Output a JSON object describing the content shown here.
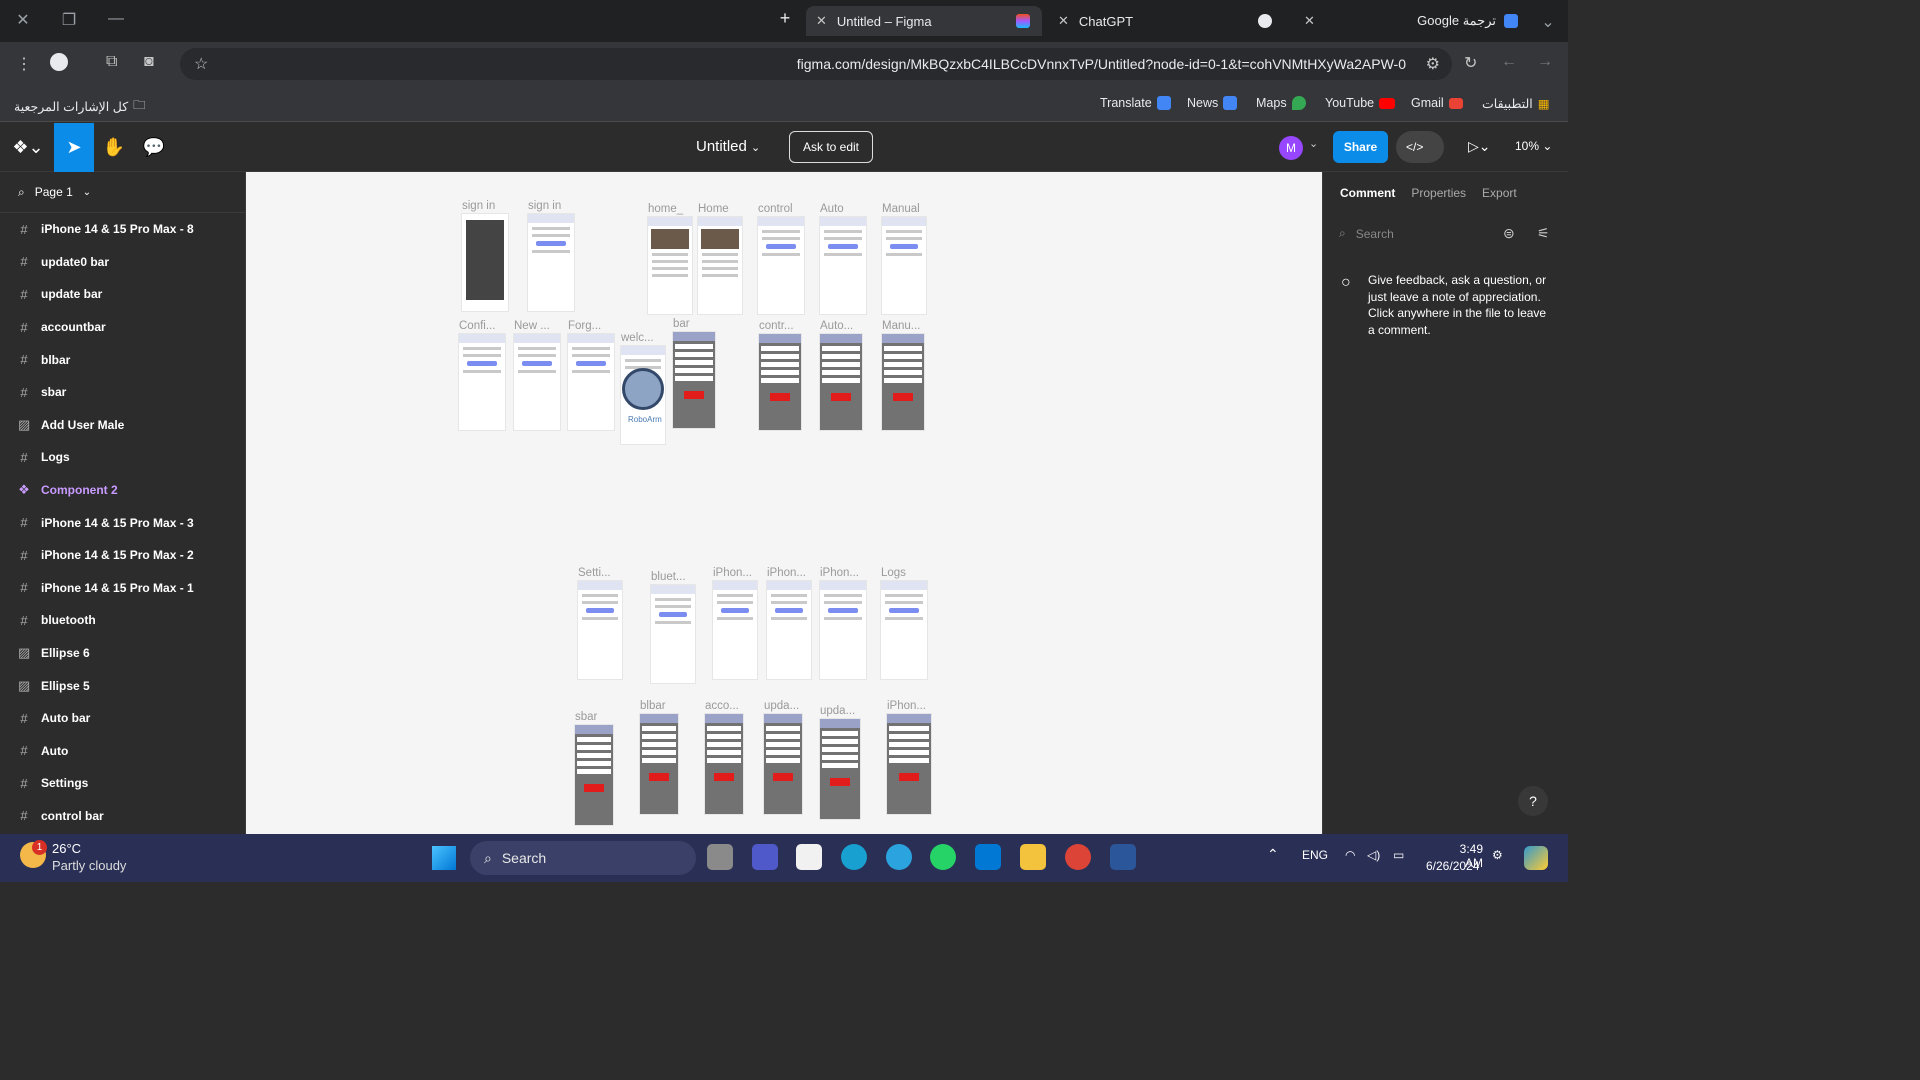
{
  "browser": {
    "tabs": [
      {
        "label": "Untitled – Figma",
        "active": true
      },
      {
        "label": "ChatGPT",
        "active": false
      },
      {
        "label": "Google ترجمة",
        "active": false
      }
    ],
    "url": "figma.com/design/MkBQzxbC4ILBCcDVnnxTvP/Untitled?node-id=0-1&t=cohVNMtHXyWa2APW-0",
    "bookmarks_left": "كل الإشارات المرجعية",
    "bookmarks": [
      "Translate",
      "News",
      "Maps",
      "YouTube",
      "Gmail",
      "التطبيقات"
    ]
  },
  "figma": {
    "file_title": "Untitled",
    "ask_to_edit": "Ask to edit",
    "avatar_initial": "M",
    "share": "Share",
    "zoom": "10%",
    "page": "Page 1",
    "layers": [
      {
        "name": "iPhone 14 & 15 Pro Max - 8",
        "kind": "frame"
      },
      {
        "name": "update0 bar",
        "kind": "frame"
      },
      {
        "name": "update bar",
        "kind": "frame"
      },
      {
        "name": "accountbar",
        "kind": "frame"
      },
      {
        "name": "blbar",
        "kind": "frame"
      },
      {
        "name": "sbar",
        "kind": "frame"
      },
      {
        "name": "Add User Male",
        "kind": "image"
      },
      {
        "name": "Logs",
        "kind": "frame"
      },
      {
        "name": "Component 2",
        "kind": "component"
      },
      {
        "name": "iPhone 14 & 15 Pro Max - 3",
        "kind": "frame"
      },
      {
        "name": "iPhone 14 & 15 Pro Max - 2",
        "kind": "frame"
      },
      {
        "name": "iPhone 14 & 15 Pro Max - 1",
        "kind": "frame"
      },
      {
        "name": "bluetooth",
        "kind": "frame"
      },
      {
        "name": "Ellipse 6",
        "kind": "image"
      },
      {
        "name": "Ellipse 5",
        "kind": "image"
      },
      {
        "name": "Auto bar",
        "kind": "frame"
      },
      {
        "name": "Auto",
        "kind": "frame"
      },
      {
        "name": "Settings",
        "kind": "frame"
      },
      {
        "name": "control bar",
        "kind": "frame"
      }
    ],
    "right_tabs": [
      "Comment",
      "Properties",
      "Export"
    ],
    "search_placeholder": "Search",
    "comment_hint": "Give feedback, ask a question, or just leave a note of appreciation. Click anywhere in the file to leave a comment.",
    "help": "?",
    "canvas_frames": {
      "row1": [
        "sign in",
        "sign in",
        "home_",
        "Home",
        "control",
        "Auto",
        "Manual"
      ],
      "row2": [
        "Confi...",
        "New ...",
        "Forg...",
        "welc...",
        "bar",
        "contr...",
        "Auto...",
        "Manu..."
      ],
      "row3": [
        "Setti...",
        "bluet...",
        "iPhon...",
        "iPhon...",
        "iPhon...",
        "Logs"
      ],
      "row4": [
        "sbar",
        "blbar",
        "acco...",
        "upda...",
        "upda...",
        "iPhon..."
      ],
      "robo_label": "RoboArm"
    }
  },
  "taskbar": {
    "weather_temp": "26°C",
    "weather_desc": "Partly cloudy",
    "weather_badge": "1",
    "search": "Search",
    "lang": "ENG",
    "time": "3:49 AM",
    "date": "6/26/2024"
  }
}
